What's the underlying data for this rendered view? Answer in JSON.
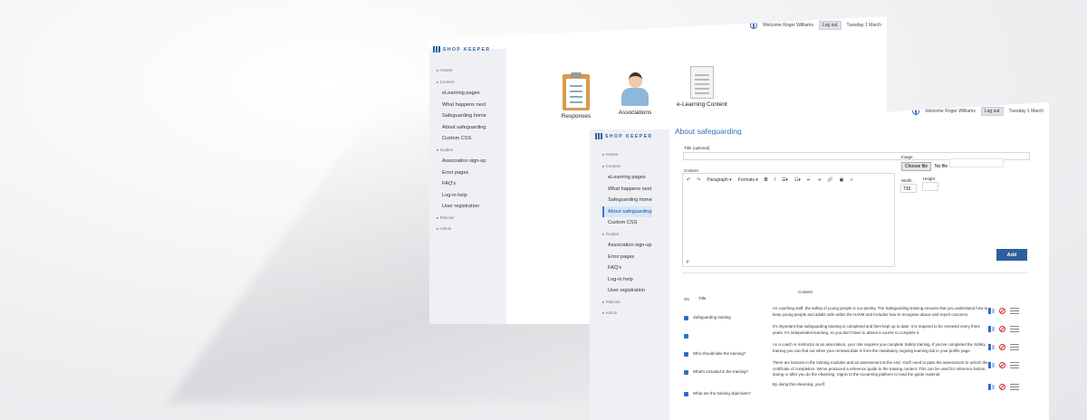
{
  "back": {
    "logo": "SHOP KEEPER",
    "welcome": "Welcome Roger Williams",
    "logout": "Log out",
    "date": "Tuesday 1 March",
    "nav": [
      {
        "label": "Assets",
        "kind": "grp"
      },
      {
        "label": "Content",
        "kind": "grp"
      },
      {
        "label": "eLearning pages",
        "kind": "sub"
      },
      {
        "label": "What happens next",
        "kind": "sub"
      },
      {
        "label": "Safeguarding home",
        "kind": "sub"
      },
      {
        "label": "About safeguarding",
        "kind": "sub"
      },
      {
        "label": "Custom CSS",
        "kind": "sub"
      },
      {
        "label": "Guides",
        "kind": "grp"
      },
      {
        "label": "Association sign-up",
        "kind": "sub"
      },
      {
        "label": "Error pages",
        "kind": "sub"
      },
      {
        "label": "FAQ's",
        "kind": "sub"
      },
      {
        "label": "Log-in help",
        "kind": "sub"
      },
      {
        "label": "User registration",
        "kind": "sub"
      },
      {
        "label": "Policies",
        "kind": "grp"
      },
      {
        "label": "Admin",
        "kind": "grp"
      }
    ],
    "tiles": [
      "Responses",
      "Associations",
      "e-Learning Content"
    ]
  },
  "front": {
    "logo": "SHOP KEEPER",
    "welcome": "Welcome Roger Williams",
    "logout": "Log out",
    "date": "Tuesday 1 March",
    "page_title": "About safeguarding",
    "nav": [
      {
        "label": "Assets",
        "kind": "grp"
      },
      {
        "label": "Content",
        "kind": "grp"
      },
      {
        "label": "eLearning pages",
        "kind": "sub"
      },
      {
        "label": "What happens next",
        "kind": "sub"
      },
      {
        "label": "Safeguarding home",
        "kind": "sub"
      },
      {
        "label": "About safeguarding",
        "kind": "active"
      },
      {
        "label": "Custom CSS",
        "kind": "sub"
      },
      {
        "label": "Guides",
        "kind": "grp"
      },
      {
        "label": "Association sign-up",
        "kind": "sub"
      },
      {
        "label": "Error pages",
        "kind": "sub"
      },
      {
        "label": "FAQ's",
        "kind": "sub"
      },
      {
        "label": "Log-in help",
        "kind": "sub"
      },
      {
        "label": "User registration",
        "kind": "sub"
      },
      {
        "label": "Policies",
        "kind": "grp"
      },
      {
        "label": "Admin",
        "kind": "grp"
      }
    ],
    "form": {
      "title_label": "Title (optional)",
      "content_label": "Content",
      "paragraph": "Paragraph",
      "formats": "Formats",
      "path": "p",
      "image_label": "Image",
      "choose_file": "Choose file",
      "no_file": "No file chosen",
      "width_label": "Width",
      "width_value": "710",
      "height_label": "Height",
      "add_button": "Add"
    },
    "table": {
      "headers": {
        "on": "On",
        "title": "Title",
        "content": "Content"
      },
      "rows": [
        {
          "title": "Safeguarding training",
          "content": "As coaching staff, the safety of young people is our priority. The Safeguarding training ensures that you understand how to keep young people and adults safe within the HAVM and includes how to recognise abuse and report concerns."
        },
        {
          "title": "",
          "content": "It's important that safeguarding training is completed and then kept up to date. It is required to be renewed every three years. It's independent learning, so you don't have to attend a course to complete it."
        },
        {
          "title": "Who should take the training?",
          "content": "As a coach or instructor at an association, your role requires you complete Safety training. If you've completed the Safety training you can find out when your renewal date is from the mandatory ongoing learning tab in your profile page."
        },
        {
          "title": "What's included in the training?",
          "content": "There are lessons in the training modules and an assessment at the end. You'll need to pass the assessment to unlock the certificate of completion. We've produced a reference guide to the training content. This can be used for reference before, during or after you do the elearning. Signin to the eLearning platform to read the guide material."
        },
        {
          "title": "What are the training objectives?",
          "content": "By doing this elearning, you'll:"
        }
      ]
    }
  }
}
